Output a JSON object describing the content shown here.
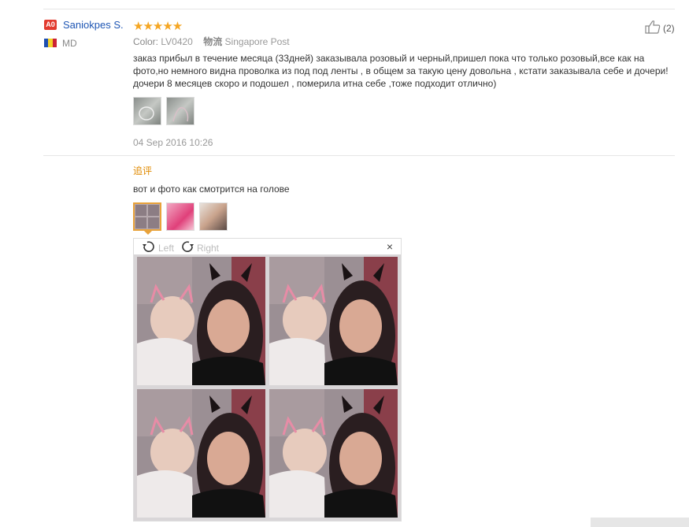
{
  "review": {
    "badge": "A0",
    "username": "Saniokpes S.",
    "country": "MD",
    "rating": "★★★★★",
    "color_label": "Color:",
    "color_value": "LV0420",
    "shipping_label": "物流",
    "shipping_value": "Singapore Post",
    "likes": "(2)",
    "text": "заказ прибыл в течение месяца (33дней) заказывала розовый и черный,пришел пока что только розовый,все как на фото,но немного видна проволка из под под ленты , в общем за такую цену довольна , кстати заказывала себе и дочери! дочери 8 месяцев скоро и подошел , померила итна себе ,тоже подходит отлично)",
    "date": "04 Sep 2016 10:26"
  },
  "followup": {
    "title": "追评",
    "text": "вот и фото как смотрится на голове"
  },
  "viewer": {
    "rotate_left": "Left",
    "rotate_right": "Right",
    "close": "×"
  },
  "colors": {
    "username": "#1e56b4",
    "star": "#f5a623",
    "followup": "#e08a00",
    "badge": "#e23b2f",
    "active_thumb_border": "#e8a23a"
  },
  "icons": {
    "thumb_up": "thumbs-up-icon",
    "rotate_left": "rotate-left-icon",
    "rotate_right": "rotate-right-icon",
    "close": "close-icon",
    "flag": "moldova-flag-icon"
  }
}
